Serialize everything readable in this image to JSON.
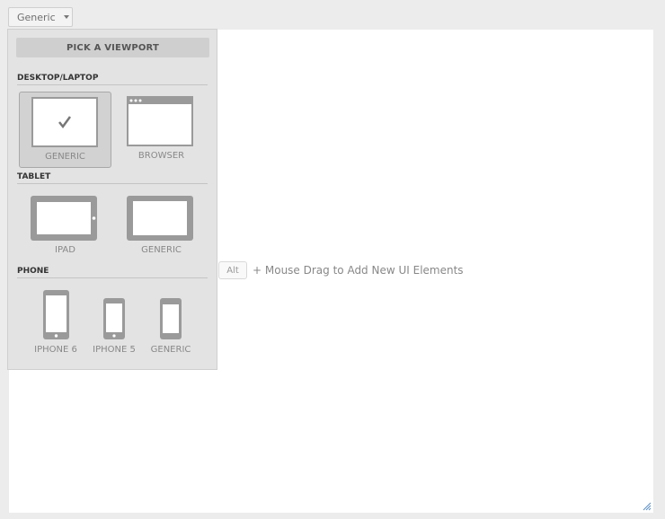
{
  "toolbar": {
    "viewport_label": "Generic"
  },
  "panel": {
    "pick_label": "PICK A VIEWPORT",
    "sections": [
      {
        "title": "DESKTOP/LAPTOP",
        "devices": [
          {
            "label": "GENERIC",
            "selected": true
          },
          {
            "label": "BROWSER",
            "selected": false
          }
        ]
      },
      {
        "title": "TABLET",
        "devices": [
          {
            "label": "IPAD",
            "selected": false
          },
          {
            "label": "GENERIC",
            "selected": false
          }
        ]
      },
      {
        "title": "PHONE",
        "devices": [
          {
            "label": "IPHONE 6",
            "selected": false
          },
          {
            "label": "IPHONE 5",
            "selected": false
          },
          {
            "label": "GENERIC",
            "selected": false
          }
        ]
      }
    ]
  },
  "hint": {
    "key": "Alt",
    "text": "+ Mouse Drag to Add New UI Elements"
  },
  "colors": {
    "device_gray": "#9a9a9a",
    "panel_bg": "#e3e3e3",
    "canvas_bg": "#ffffff"
  }
}
